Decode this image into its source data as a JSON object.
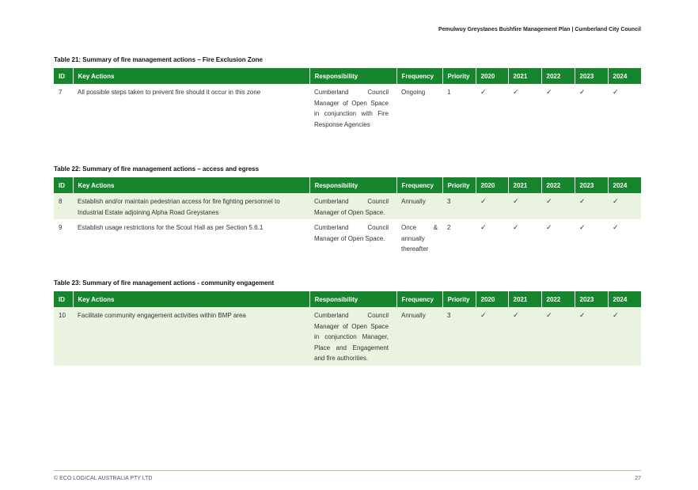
{
  "header": {
    "doc_title": "Pemulwuy Greystanes Bushfire Management Plan  |  Cumberland City Council"
  },
  "columns": [
    "ID",
    "Key Actions",
    "Responsibility",
    "Frequency",
    "Priority",
    "2020",
    "2021",
    "2022",
    "2023",
    "2024"
  ],
  "check": "✓",
  "tables": [
    {
      "title": "Table 21: Summary of fire management actions – Fire Exclusion Zone",
      "rows": [
        {
          "id": "7",
          "action": "All possible steps taken to prevent fire should it occur in this zone",
          "responsibility": "Cumberland Council Manager of Open Space in conjunction with Fire Response Agencies",
          "frequency": "Ongoing",
          "priority": "1",
          "years": [
            true,
            true,
            true,
            true,
            true
          ]
        }
      ]
    },
    {
      "title": "Table 22: Summary of fire management actions – access and egress",
      "rows": [
        {
          "id": "8",
          "action": "Establish and/or maintain pedestrian access for fire fighting personnel to Industrial Estate adjoining Alpha Road Greystanes",
          "responsibility": "Cumberland Council Manager of Open Space.",
          "frequency": "Annually",
          "priority": "3",
          "years": [
            true,
            true,
            true,
            true,
            true
          ]
        },
        {
          "id": "9",
          "action": "Establish usage restrictions for the Scout Hall as per Section 5.6.1",
          "responsibility": "Cumberland Council Manager of Open Space.",
          "frequency": "Once & annually thereafter",
          "priority": "2",
          "years": [
            true,
            true,
            true,
            true,
            true
          ]
        }
      ]
    },
    {
      "title": "Table 23: Summary of fire management actions - community engagement",
      "rows": [
        {
          "id": "10",
          "action": "Facilitate community engagement activities within BMP area",
          "responsibility": "Cumberland Council Manager of Open Space in conjunction Manager, Place and Engagement and fire authorities.",
          "frequency": "Annually",
          "priority": "3",
          "years": [
            true,
            true,
            true,
            true,
            true
          ]
        }
      ]
    }
  ],
  "footer": {
    "copyright": "© ECO LOGICAL AUSTRALIA PTY LTD",
    "page_number": "27"
  }
}
